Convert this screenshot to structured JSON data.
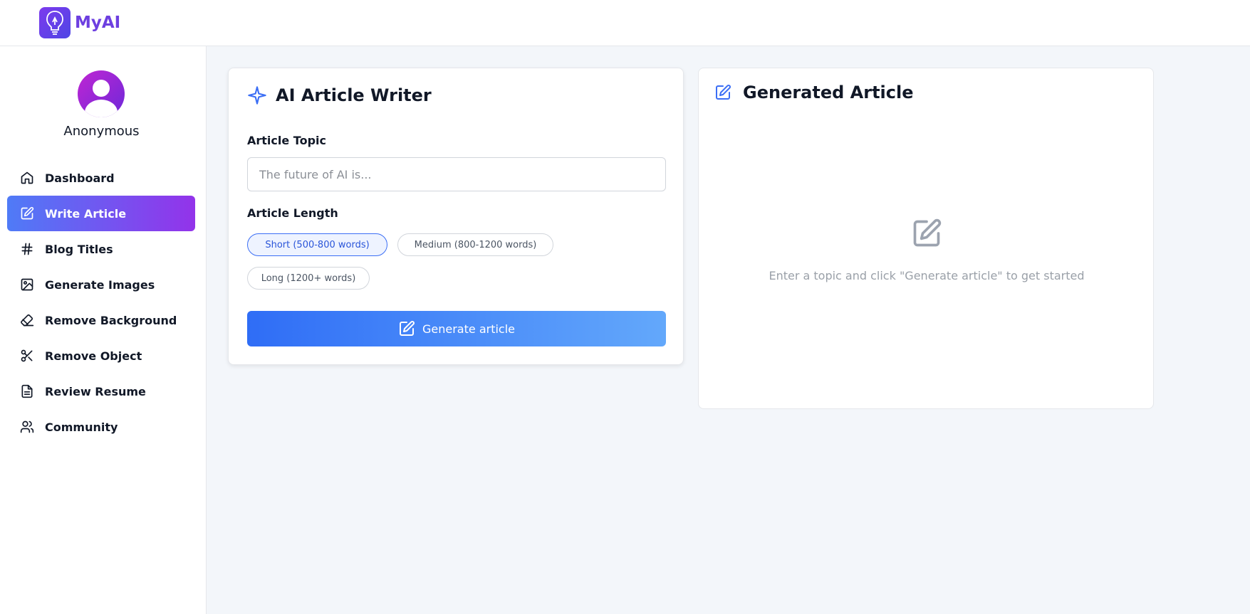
{
  "app": {
    "name": "MyAI"
  },
  "user": {
    "name": "Anonymous"
  },
  "sidebar": {
    "items": [
      {
        "label": "Dashboard",
        "icon": "home-icon"
      },
      {
        "label": "Write Article",
        "icon": "edit-icon",
        "active": true
      },
      {
        "label": "Blog Titles",
        "icon": "hash-icon"
      },
      {
        "label": "Generate Images",
        "icon": "image-icon"
      },
      {
        "label": "Remove Background",
        "icon": "eraser-icon"
      },
      {
        "label": "Remove Object",
        "icon": "scissors-icon"
      },
      {
        "label": "Review Resume",
        "icon": "file-text-icon"
      },
      {
        "label": "Community",
        "icon": "users-icon"
      }
    ]
  },
  "writer": {
    "title": "AI Article Writer",
    "topic_label": "Article Topic",
    "topic_placeholder": "The future of AI is...",
    "topic_value": "",
    "length_label": "Article Length",
    "length_options": [
      {
        "label": "Short (500-800 words)",
        "selected": true
      },
      {
        "label": "Medium (800-1200 words)",
        "selected": false
      },
      {
        "label": "Long (1200+ words)",
        "selected": false
      }
    ],
    "generate_label": "Generate article"
  },
  "result": {
    "title": "Generated Article",
    "empty_message": "Enter a topic and click \"Generate article\" to get started"
  },
  "colors": {
    "brand": "#6d3fe0",
    "accent_blue": "#2f6df6",
    "active_gradient_start": "#4f7bf7",
    "active_gradient_end": "#9333ea",
    "background": "#f3f6fa"
  }
}
